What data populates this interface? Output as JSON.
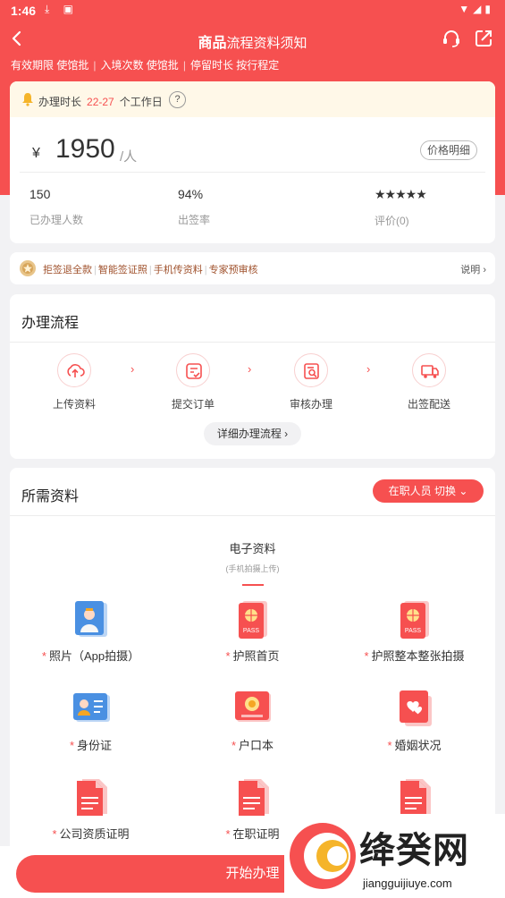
{
  "status_bar": {
    "time": "1:46"
  },
  "nav": {
    "title_bold": "商品",
    "title_rest": "流程资料须知"
  },
  "subtags": [
    "有效期限 使馆批",
    "入境次数 使馆批",
    "停留时长 按行程定"
  ],
  "notice": {
    "label": "办理时长",
    "days": "22-27",
    "unit": "个工作日",
    "help": "?"
  },
  "price": {
    "currency": "¥",
    "amount": "1950",
    "per": "/人",
    "detail_button": "价格明细"
  },
  "stats": [
    {
      "value": "150",
      "label": "已办理人数"
    },
    {
      "value": "94%",
      "label": "出签率"
    },
    {
      "value": "★★★★★",
      "label": "评价(0)"
    }
  ],
  "promo": {
    "items": [
      "拒签退全款",
      "智能签证照",
      "手机传资料",
      "专家预审核"
    ],
    "explain": "说明"
  },
  "process": {
    "title": "办理流程",
    "steps": [
      {
        "label": "上传资料",
        "icon": "upload-icon"
      },
      {
        "label": "提交订单",
        "icon": "submit-order-icon"
      },
      {
        "label": "审核办理",
        "icon": "review-icon"
      },
      {
        "label": "出签配送",
        "icon": "delivery-truck-icon"
      }
    ],
    "detail_button": "详细办理流程"
  },
  "materials": {
    "title": "所需资料",
    "switch_button": "在职人员 切换",
    "tab_title": "电子资料",
    "tab_subtitle": "(手机拍摄上传)",
    "required_mark": "*",
    "items": [
      {
        "label": "照片（App拍摄）",
        "icon": "photo-icon"
      },
      {
        "label": "护照首页",
        "icon": "passport-icon"
      },
      {
        "label": "护照整本整张拍摄",
        "icon": "passport-icon"
      },
      {
        "label": "身份证",
        "icon": "id-card-icon"
      },
      {
        "label": "户口本",
        "icon": "household-register-icon"
      },
      {
        "label": "婚姻状况",
        "icon": "marriage-icon"
      },
      {
        "label": "公司资质证明",
        "icon": "document-icon"
      },
      {
        "label": "在职证明",
        "icon": "document-icon"
      },
      {
        "label": "",
        "icon": "document-icon"
      }
    ]
  },
  "bottom": {
    "start_button": "开始办理"
  },
  "watermark": {
    "name": "绛癸网",
    "url": "jiangguijiuye.com"
  },
  "colors": {
    "accent": "#f65050",
    "notice_bg": "#fff8e8",
    "promo_text": "#a0522d"
  }
}
